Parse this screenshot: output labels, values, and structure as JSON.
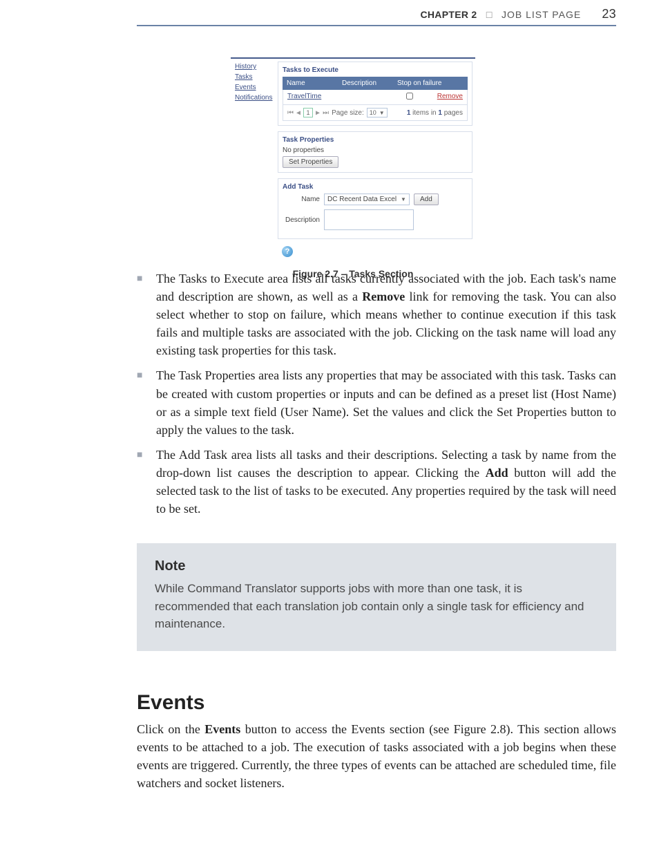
{
  "header": {
    "chapter": "CHAPTER 2",
    "title": "JOB LIST PAGE",
    "page": "23"
  },
  "screenshot": {
    "side_tabs": [
      "History",
      "Tasks",
      "Events",
      "Notifications"
    ],
    "panel1_title": "Tasks to Execute",
    "grid": {
      "headers": {
        "name": "Name",
        "desc": "Description",
        "stop": "Stop on failure"
      },
      "row": {
        "name": "TravelTime",
        "remove": "Remove"
      },
      "pager": {
        "page": "1",
        "label": "Page size:",
        "size": "10",
        "summary_a": "1",
        "summary_mid": " items in ",
        "summary_b": "1",
        "summary_end": " pages"
      }
    },
    "panel2_title": "Task Properties",
    "noprop": "No properties",
    "setprop": "Set Properties",
    "panel3_title": "Add Task",
    "add": {
      "name_lbl": "Name",
      "name_val": "DC Recent Data Excel",
      "add_btn": "Add",
      "desc_lbl": "Description"
    }
  },
  "fig_caption": "Figure 2.7 – Tasks Section",
  "bullets": {
    "b1": "The Tasks to Execute area lists all tasks currently associated with the job. Each task's name and description are shown, as well as a ",
    "b1b": "Remove",
    "b1c": " link for removing the task. You can also select whether to stop on failure, which means whether to continue execution if this task fails and multiple tasks are associated with the job. Clicking on the task name will load any existing task properties for this task.",
    "b2": "The Task Properties area lists any properties that may be associated with this task. Tasks can be created with custom properties or inputs and can be defined as a preset list (Host Name) or as a simple text field (User Name). Set the values and click the Set Properties button to apply the values to the task.",
    "b3a": "The Add Task area lists all tasks and their descriptions. Selecting a task by name from the drop-down list causes the description to appear. Clicking the ",
    "b3b": "Add",
    "b3c": " button will add the selected task to the list of tasks to be executed. Any properties required by the task will need to be set."
  },
  "note": {
    "heading": "Note",
    "body": "While Command Translator supports jobs with more than one task, it is recommended that each translation job contain only a single task for efficiency and maintenance."
  },
  "events": {
    "heading": "Events",
    "p1a": "Click on the ",
    "p1b": "Events",
    "p1c": " button to access the Events section (see Figure 2.8). This section allows events to be attached to a job. The execution of tasks associated with a job begins when these events are triggered. Currently, the three types of events can be attached are scheduled time, file watchers and socket listeners."
  }
}
